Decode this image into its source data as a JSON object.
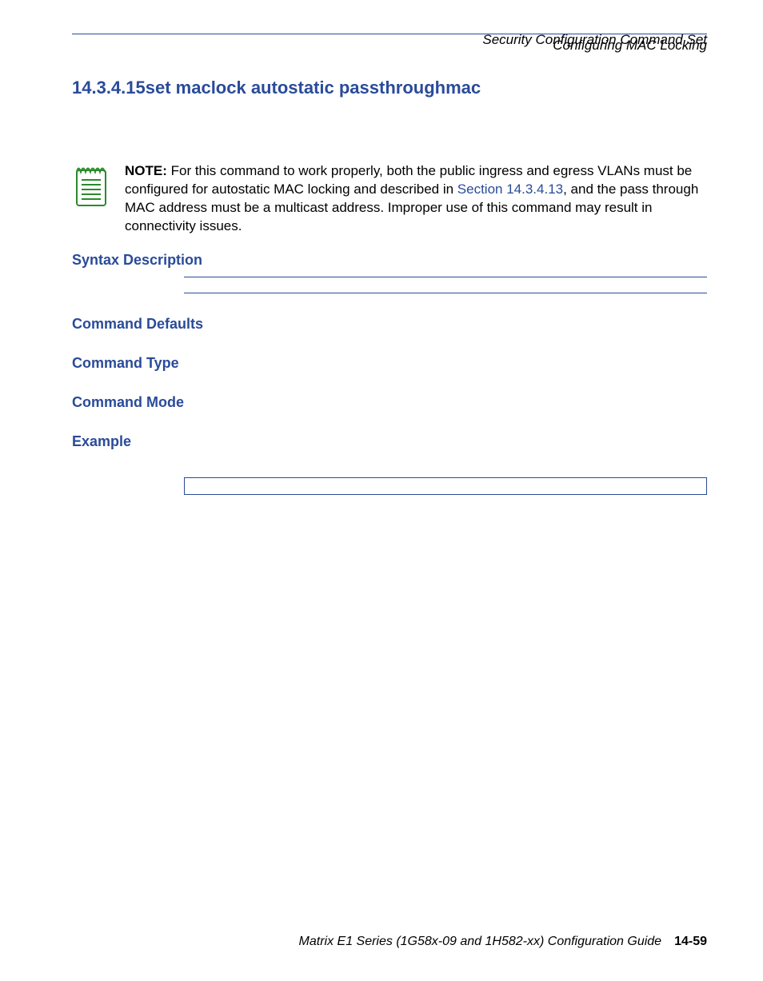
{
  "header": {
    "line1": "Security Configuration Command Set",
    "line2": "Configuring MAC Locking"
  },
  "section": {
    "number": "14.3.4.15",
    "title": "set maclock autostatic passthroughmac"
  },
  "note": {
    "label": "NOTE:",
    "text_before_link": "  For this command to work properly, both the public ingress and egress VLANs must be configured for autostatic MAC locking and described in ",
    "link": "Section 14.3.4.13",
    "text_after_link": ", and the pass through MAC address must be a multicast address. Improper use of this command may result in connectivity issues."
  },
  "headings": {
    "syntax_description": "Syntax Description",
    "command_defaults": "Command Defaults",
    "command_type": "Command Type",
    "command_mode": "Command Mode",
    "example": "Example"
  },
  "footer": {
    "guide": "Matrix E1 Series (1G58x-09 and 1H582-xx) Configuration Guide",
    "pagenum": "14-59"
  }
}
